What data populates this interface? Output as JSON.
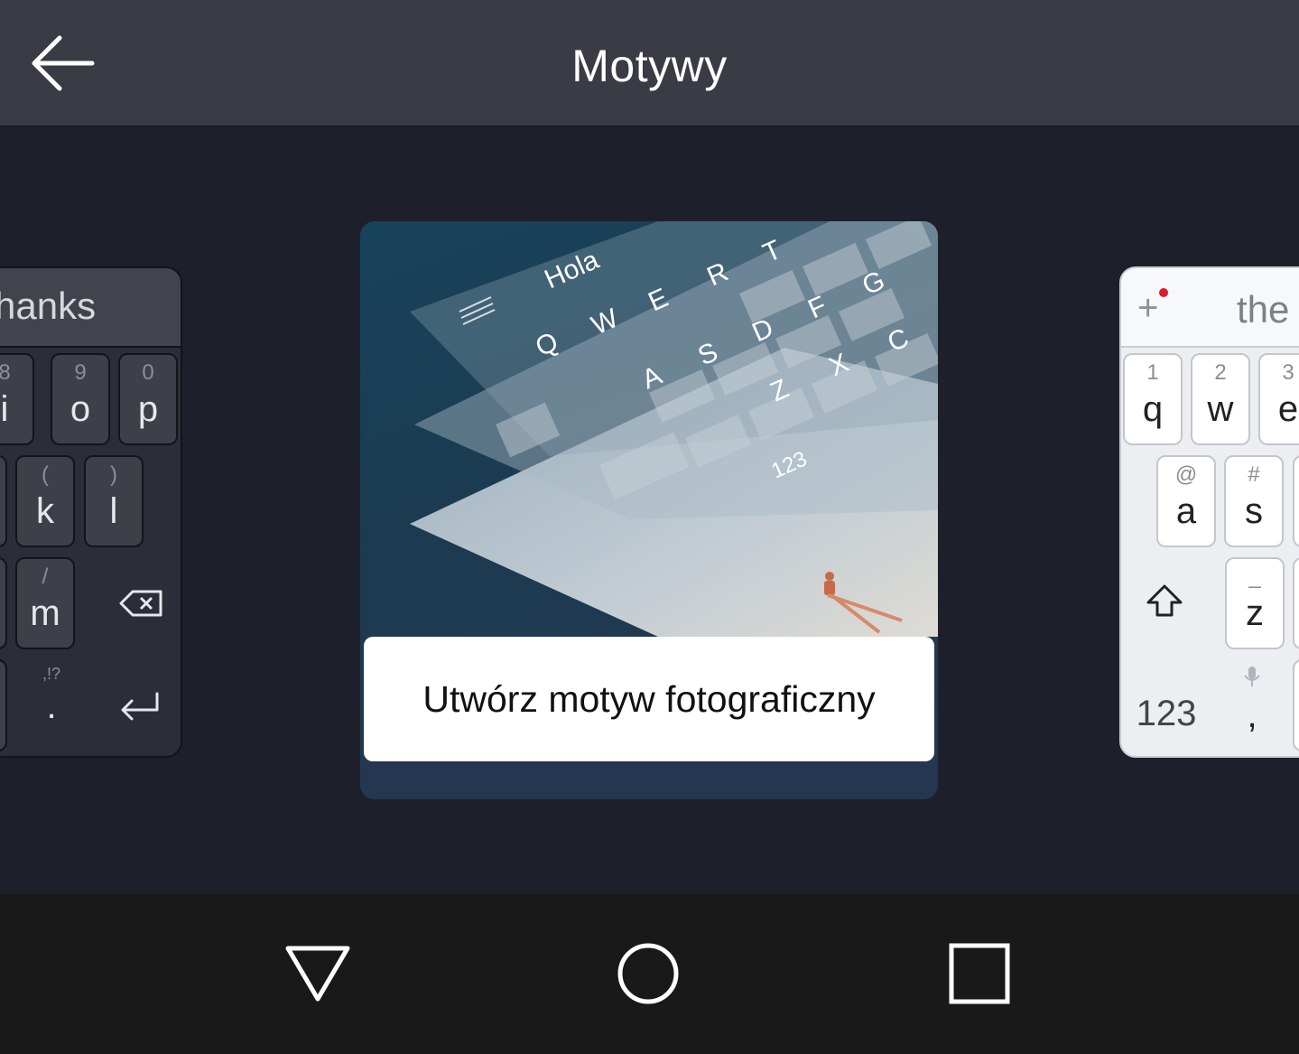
{
  "app_bar": {
    "title": "Motywy",
    "back_icon": "arrow-left-icon"
  },
  "themes": {
    "left_card": {
      "suggestion": "hanks",
      "rows": [
        [
          {
            "hint": "8",
            "key": "i"
          },
          {
            "hint": "9",
            "key": "o"
          },
          {
            "hint": "0",
            "key": "p"
          }
        ],
        [
          {
            "hint": "(",
            "key": "k"
          },
          {
            "hint": ")",
            "key": "l"
          }
        ],
        [
          {
            "hint": "/",
            "key": "m"
          }
        ],
        [
          {
            "hint": ",!?",
            "key": "."
          }
        ]
      ],
      "backspace_icon": "backspace-icon",
      "enter_icon": "enter-icon"
    },
    "center_card": {
      "label": "Utwórz motyw fotograficzny",
      "preview_word": "Hola",
      "preview_keys_row1": [
        "Q",
        "W",
        "E",
        "R",
        "T"
      ],
      "preview_keys_row2": [
        "A",
        "S",
        "D",
        "F",
        "G"
      ],
      "preview_keys_row3": [
        "Z",
        "X",
        "C"
      ],
      "preview_numeric_key": "123"
    },
    "right_card": {
      "suggestion": "the",
      "plus_icon": "plus-icon",
      "rows": [
        [
          {
            "hint": "1",
            "key": "q"
          },
          {
            "hint": "2",
            "key": "w"
          },
          {
            "hint": "3",
            "key": "e"
          }
        ],
        [
          {
            "hint": "@",
            "key": "a"
          },
          {
            "hint": "#",
            "key": "s"
          }
        ],
        [
          {
            "hint": "_",
            "key": "z"
          }
        ],
        [
          {
            "hint": "",
            "key": "123"
          },
          {
            "hint": "",
            "key": ","
          }
        ]
      ],
      "shift_icon": "shift-icon",
      "mic_icon": "mic-icon"
    }
  },
  "nav_bar": {
    "back_icon": "nav-back-triangle-icon",
    "home_icon": "nav-home-circle-icon",
    "recents_icon": "nav-recents-square-icon"
  }
}
